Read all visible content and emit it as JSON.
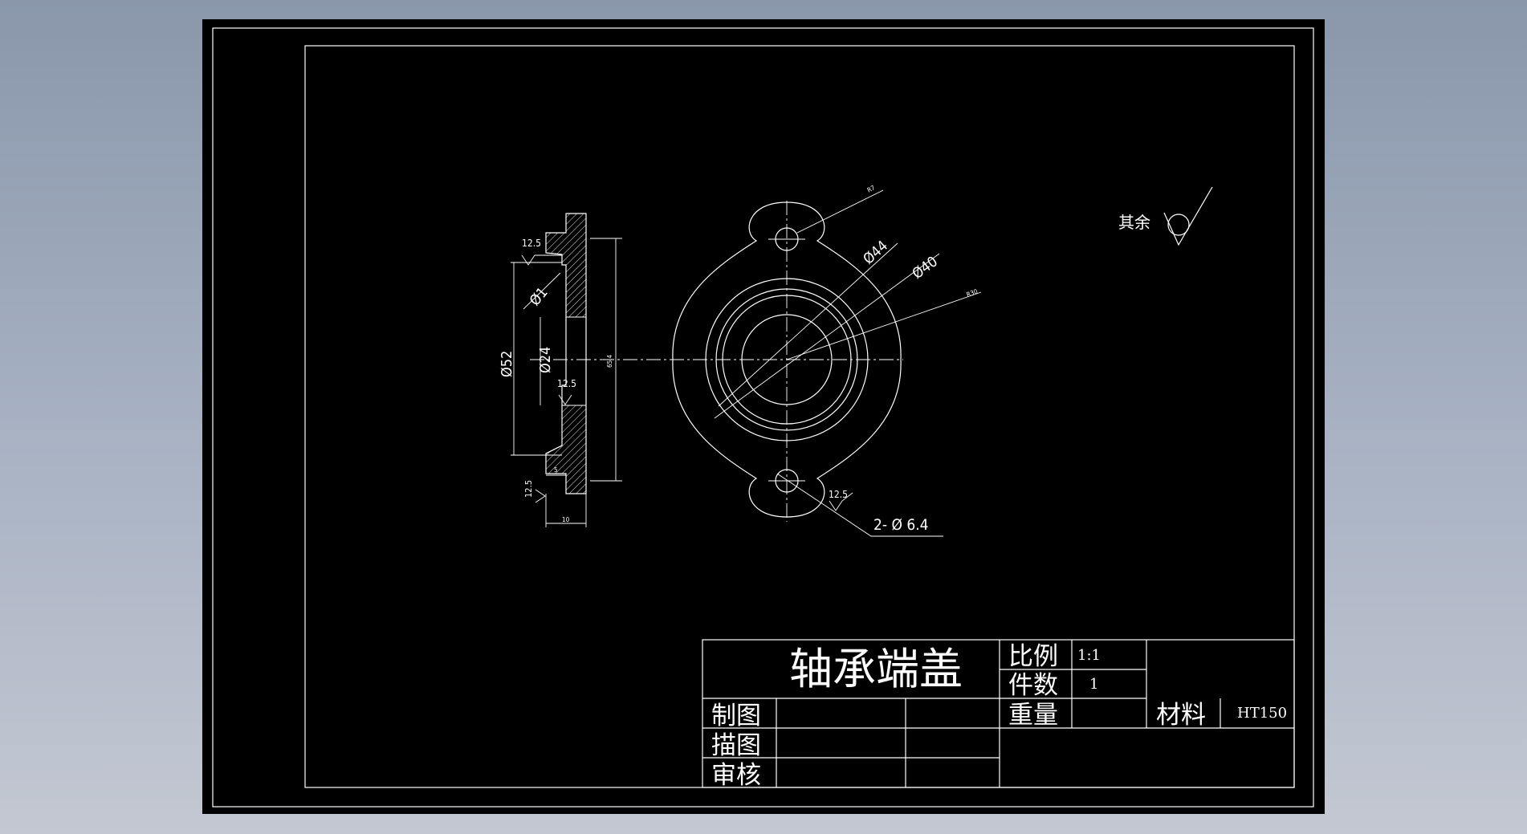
{
  "title_block": {
    "part_name": "轴承端盖",
    "scale_label": "比例",
    "scale_value": "1:1",
    "quantity_label": "件数",
    "quantity_value": "1",
    "weight_label": "重量",
    "material_label": "材料",
    "material_value": "HT150",
    "drawn_label": "制图",
    "traced_label": "描图",
    "checked_label": "审核"
  },
  "roughness": {
    "other_label": "其余",
    "value": "12.5"
  },
  "side_view": {
    "dims": {
      "d52": "Ø52",
      "d24": "Ø24",
      "d1": "Ø1",
      "height": "65.4",
      "thickness": "10",
      "step": "5"
    }
  },
  "front_view": {
    "dims": {
      "d44": "Ø44",
      "d40": "Ø40",
      "r7": "R7",
      "r30": "R30",
      "holes": "2- Ø 6.4"
    }
  },
  "colors": {
    "paper": "#000000",
    "ink": "#ffffff",
    "background_top": "#8a97ab",
    "background_bottom": "#c3c8d2"
  }
}
